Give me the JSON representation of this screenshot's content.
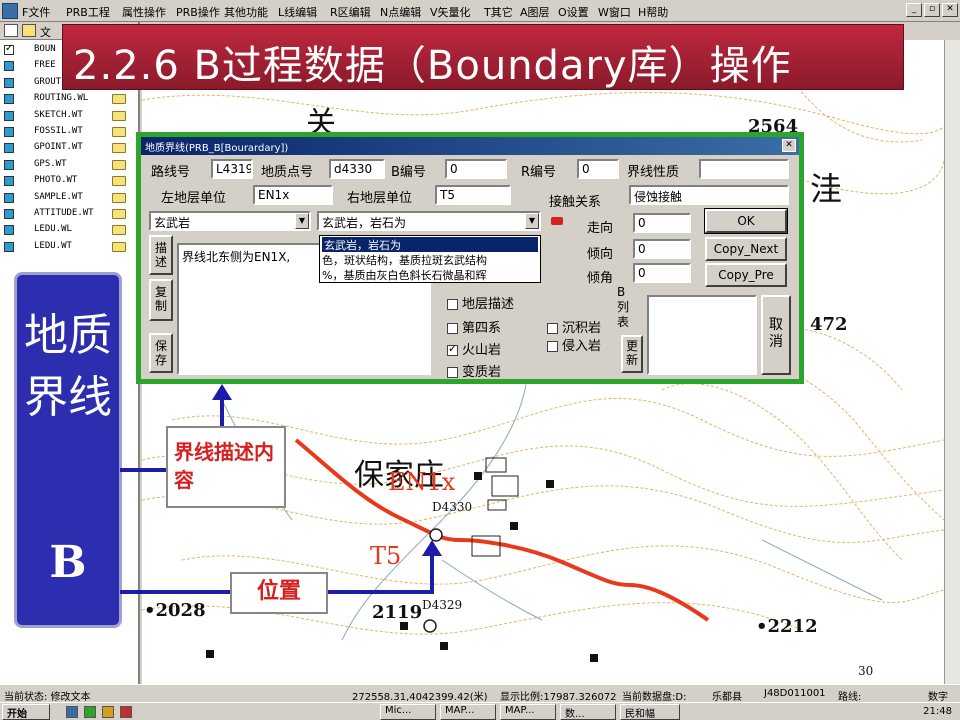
{
  "menubar": {
    "items": [
      "F文件",
      "PRB工程",
      "属性操作",
      "PRB操作",
      "其他功能",
      "L线编辑",
      "R区编辑",
      "N点编辑",
      "V矢量化",
      "T其它",
      "A图层",
      "O设置",
      "W窗口",
      "H帮助"
    ]
  },
  "title_banner": "2.2.6  B过程数据（Boundary库）操作",
  "tree": {
    "header": "文",
    "items": [
      {
        "label": "BOUN",
        "checked": true
      },
      {
        "label": "FREE",
        "checked": false
      },
      {
        "label": "GROUTE.WL",
        "checked": false
      },
      {
        "label": "ROUTING.WL",
        "checked": false
      },
      {
        "label": "SKETCH.WT",
        "checked": false
      },
      {
        "label": "FOSSIL.WT",
        "checked": false
      },
      {
        "label": "GPOINT.WT",
        "checked": false
      },
      {
        "label": "GPS.WT",
        "checked": false
      },
      {
        "label": "PHOTO.WT",
        "checked": false
      },
      {
        "label": "SAMPLE.WT",
        "checked": false
      },
      {
        "label": "ATTITUDE.WT",
        "checked": false
      },
      {
        "label": "LEDU.WL",
        "checked": false
      },
      {
        "label": "LEDU.WT",
        "checked": false
      }
    ]
  },
  "dialog": {
    "title": "地质界线(PRB_B[Bourardary])",
    "route_label": "路线号",
    "route_value": "L4319",
    "point_label": "地质点号",
    "point_value": "d4330",
    "b_label": "B编号",
    "b_value": "0",
    "r_label": "R编号",
    "r_value": "0",
    "nature_label": "界线性质",
    "nature_value": "",
    "left_unit_label": "左地层单位",
    "left_unit_value": "EN1x",
    "right_unit_label": "右地层单位",
    "right_unit_value": "T5",
    "contact_label": "接触关系",
    "contact_value": "侵蚀接触",
    "rock_combo": "玄武岩",
    "desc_combo": "玄武岩，岩石为",
    "dropdown": [
      "玄武岩，岩石为",
      "色，斑状结构，基质拉斑玄武结构",
      "%，基质由灰白色斜长石微晶和辉"
    ],
    "strike_label": "走向",
    "strike_value": "0",
    "dip_label": "倾向",
    "dip_value": "0",
    "angle_label": "倾角",
    "angle_value": "0",
    "ok": "OK",
    "copy_next": "Copy_Next",
    "copy_pre": "Copy_Pre",
    "cancel": "取消",
    "side_describe": "描述",
    "side_copy": "复制",
    "side_save": "保存",
    "desc_text": "界线北东侧为EN1X,",
    "chk_strat": "地层描述",
    "chk_quat": "第四系",
    "chk_volc": "火山岩",
    "chk_meta": "变质岩",
    "chk_sed": "沉积岩",
    "chk_intr": "侵入岩",
    "b_list_label": "B列表",
    "refresh": "更新"
  },
  "map": {
    "labels": {
      "village": "保家庄",
      "en1x": "EN1x",
      "t5": "T5",
      "d4330": "D4330",
      "d4329": "D4329",
      "h2564": "2564",
      "h472": "472",
      "h2028": "•2028",
      "h2119": "2119",
      "h2212": "•2212",
      "page_num": "30",
      "frag_top": "关",
      "frag_right": "洼"
    }
  },
  "left_scroll": {
    "title": "地质界线",
    "letter": "B"
  },
  "annotations": {
    "boundary_desc": "界线描述内容",
    "position": "位置"
  },
  "status": {
    "state": "当前状态: 修改文本",
    "coords": "272558.31,4042399.42(米)",
    "scale": "显示比例:17987.326072",
    "disk": "当前数据盘:D:",
    "county": "乐都县",
    "sheet": "J48D011001",
    "route": "路线:",
    "mode": "数字"
  },
  "taskbar": {
    "start": "开始",
    "tasks": [
      "Mic...",
      "MAP...",
      "MAP...",
      "数...",
      "民和幅"
    ],
    "clock": "21:48"
  },
  "colors": {
    "banner": "#b0213a",
    "boundary_line": "#e8391c",
    "contour": "#e0a040",
    "scroll": "#2d2db0"
  }
}
